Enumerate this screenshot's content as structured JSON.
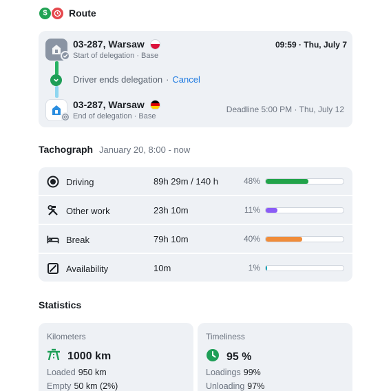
{
  "route": {
    "title": "Route",
    "start": {
      "name": "03-287, Warsaw",
      "subtitle": "Start of delegation · Base",
      "time": "09:59 · Thu, July 7",
      "flag": "poland"
    },
    "middle": {
      "text": "Driver ends delegation",
      "separator": "·",
      "cancel_label": "Cancel"
    },
    "end": {
      "name": "03-287, Warsaw",
      "subtitle": "End of delegation · Base",
      "deadline": "Deadline 5:00 PM · Thu, July 12",
      "flag": "germany"
    }
  },
  "tachograph": {
    "title": "Tachograph",
    "range": "January 20, 8:00 - now",
    "rows": [
      {
        "label": "Driving",
        "value": "89h 29m / 140 h",
        "percent_text": "48%",
        "fraction": 0.55,
        "color": "#22a34a",
        "icon": "driving-icon"
      },
      {
        "label": "Other work",
        "value": "23h 10m",
        "percent_text": "11%",
        "fraction": 0.15,
        "color": "#8b5cf6",
        "icon": "hammer-wrench-icon"
      },
      {
        "label": "Break",
        "value": "79h 10m",
        "percent_text": "40%",
        "fraction": 0.47,
        "color": "#f08c3a",
        "icon": "bed-icon"
      },
      {
        "label": "Availability",
        "value": "10m",
        "percent_text": "1%",
        "fraction": 0.02,
        "color": "#14a4b8",
        "icon": "availability-icon"
      }
    ]
  },
  "statistics": {
    "title": "Statistics",
    "kilometers": {
      "head": "Kilometers",
      "main": "1000 km",
      "icon": "road-icon",
      "lines": [
        {
          "label": "Loaded",
          "value": "950 km"
        },
        {
          "label": "Empty",
          "value": "50 km (2%)"
        }
      ]
    },
    "timeliness": {
      "head": "Timeliness",
      "main": "95 %",
      "icon": "clock-icon",
      "lines": [
        {
          "label": "Loadings",
          "value": "99%"
        },
        {
          "label": "Unloading",
          "value": "97%"
        }
      ]
    }
  }
}
